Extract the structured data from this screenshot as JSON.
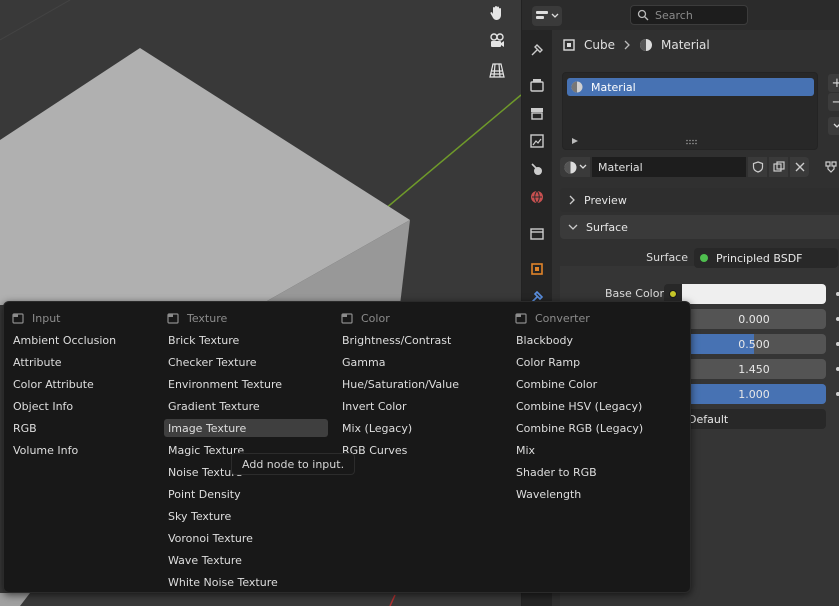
{
  "header": {
    "search_placeholder": "Search"
  },
  "breadcrumb": {
    "object": "Cube",
    "material": "Material"
  },
  "material_slots": {
    "items": [
      "Material"
    ]
  },
  "material_selector": {
    "name": "Material"
  },
  "panels": {
    "preview": "Preview",
    "surface": "Surface"
  },
  "surface": {
    "surface_label": "Surface",
    "surface_value": "Principled BSDF",
    "base_color_label": "Base Color",
    "fields": [
      {
        "value": "0.000",
        "fill": 0.0
      },
      {
        "value": "0.500",
        "fill": 0.5
      },
      {
        "value": "1.450",
        "fill": 0.0
      },
      {
        "value": "1.000",
        "fill": 1.0
      }
    ],
    "distribution": "Default"
  },
  "menu": {
    "columns": [
      {
        "header": "Input",
        "items": [
          "Ambient Occlusion",
          "Attribute",
          "Color Attribute",
          "Object Info",
          "RGB",
          "Volume Info"
        ]
      },
      {
        "header": "Texture",
        "items": [
          "Brick Texture",
          "Checker Texture",
          "Environment Texture",
          "Gradient Texture",
          "Image Texture",
          "Magic Texture",
          "Noise Texture",
          "Point Density",
          "Sky Texture",
          "Voronoi Texture",
          "Wave Texture",
          "White Noise Texture"
        ]
      },
      {
        "header": "Color",
        "items": [
          "Brightness/Contrast",
          "Gamma",
          "Hue/Saturation/Value",
          "Invert Color",
          "Mix (Legacy)",
          "RGB Curves"
        ]
      },
      {
        "header": "Converter",
        "items": [
          "Blackbody",
          "Color Ramp",
          "Combine Color",
          "Combine HSV (Legacy)",
          "Combine RGB (Legacy)",
          "Mix",
          "Shader to RGB",
          "Wavelength"
        ]
      }
    ],
    "highlighted": "Image Texture"
  },
  "tooltip": "Add node to input.",
  "colors": {
    "accent": "#4772b3",
    "shader_dot": "#4fbf4f",
    "color_dot": "#c7c729"
  }
}
